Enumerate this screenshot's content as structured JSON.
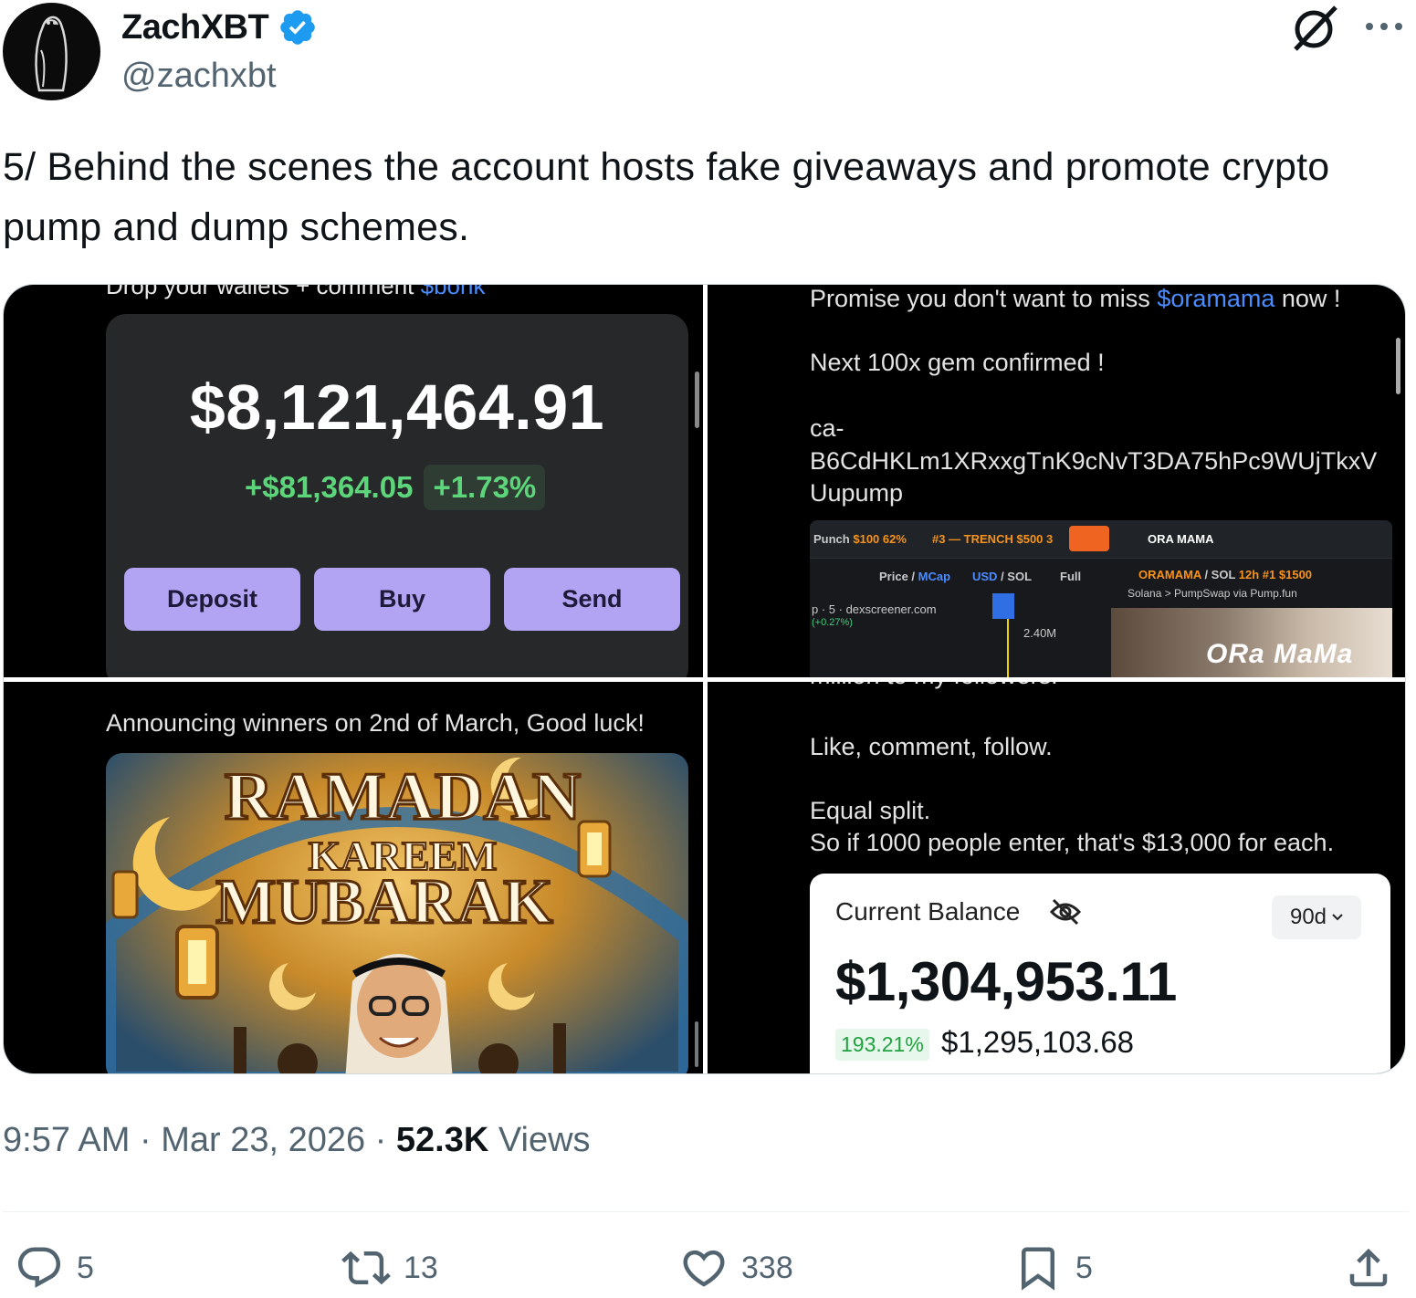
{
  "author": {
    "display_name": "ZachXBT",
    "handle": "@zachxbt",
    "verified": true
  },
  "tweet": {
    "text": "5/ Behind the scenes the account hosts fake giveaways and promote crypto pump and dump schemes."
  },
  "media": {
    "wallet": {
      "cut_text_a": "Drop your wallets + comment ",
      "cut_text_b": "$bonk",
      "total": "$8,121,464.91",
      "change_amount": "+$81,364.05",
      "change_percent": "+1.73%",
      "buttons": [
        "Deposit",
        "Buy",
        "Send"
      ]
    },
    "promo": {
      "line1_a": "Promise you don't want to miss ",
      "line1_ticker": "$oramama",
      "line1_b": " now !",
      "line2": "Next 100x gem confirmed !",
      "line3": "ca-",
      "line4": "B6CdHKLm1XRxxgTnK9cNvT3DA75hPc9WUjTkxV",
      "line5": "Uupump",
      "dex": {
        "tab1": "Punch",
        "tab1_val": "$100 62%",
        "tab2": "#3 — TRENCH",
        "tab2_val": "$500 3",
        "pair_name": "ORA MAMA",
        "row2_a": "Price / ",
        "row2_b": "MCap",
        "row2_c": "USD",
        "row2_d": " / SOL",
        "row2_e": "Full",
        "token": "ORAMAMA",
        "token_pair": " / SOL",
        "token_stats": "12h  #1  $1500",
        "chain": "Solana  >  PumpSwap  via  Pump.fun",
        "source": "p · 5 · dexscreener.com",
        "source_pct": "(+0.27%)",
        "axis_val": "2.40M",
        "banner_text": "ORa MaMa"
      }
    },
    "ramadan": {
      "caption": "Announcing winners on 2nd of March, Good luck!",
      "title1": "RAMADAN",
      "title2": "KAREEM",
      "title3": "MUBARAK"
    },
    "balance": {
      "cut_text": "million to my followers.",
      "line1": "Like, comment, follow.",
      "line2": "Equal split.",
      "line3": "So if 1000 people enter, that's $13,000 for each.",
      "label": "Current Balance",
      "range": "90d",
      "amount": "$1,304,953.11",
      "percent": "193.21%",
      "gain": "$1,295,103.68"
    }
  },
  "meta": {
    "time": "9:57 AM",
    "sep1": " · ",
    "date": "Mar 23, 2026",
    "sep2": " · ",
    "views_count": "52.3K",
    "views_label": " Views"
  },
  "actions": {
    "replies": "5",
    "reposts": "13",
    "likes": "338",
    "bookmarks": "5"
  },
  "colors": {
    "verified": "#1d9bf0",
    "text_primary": "#0f1419",
    "text_secondary": "#536471",
    "wallet_green": "#5dd57a",
    "wallet_button": "#b2a4f2"
  },
  "icons": [
    "verified-badge-icon",
    "grok-icon",
    "more-icon",
    "reply-icon",
    "repost-icon",
    "like-icon",
    "bookmark-icon",
    "share-icon",
    "eye-off-icon",
    "chevron-down-icon"
  ]
}
